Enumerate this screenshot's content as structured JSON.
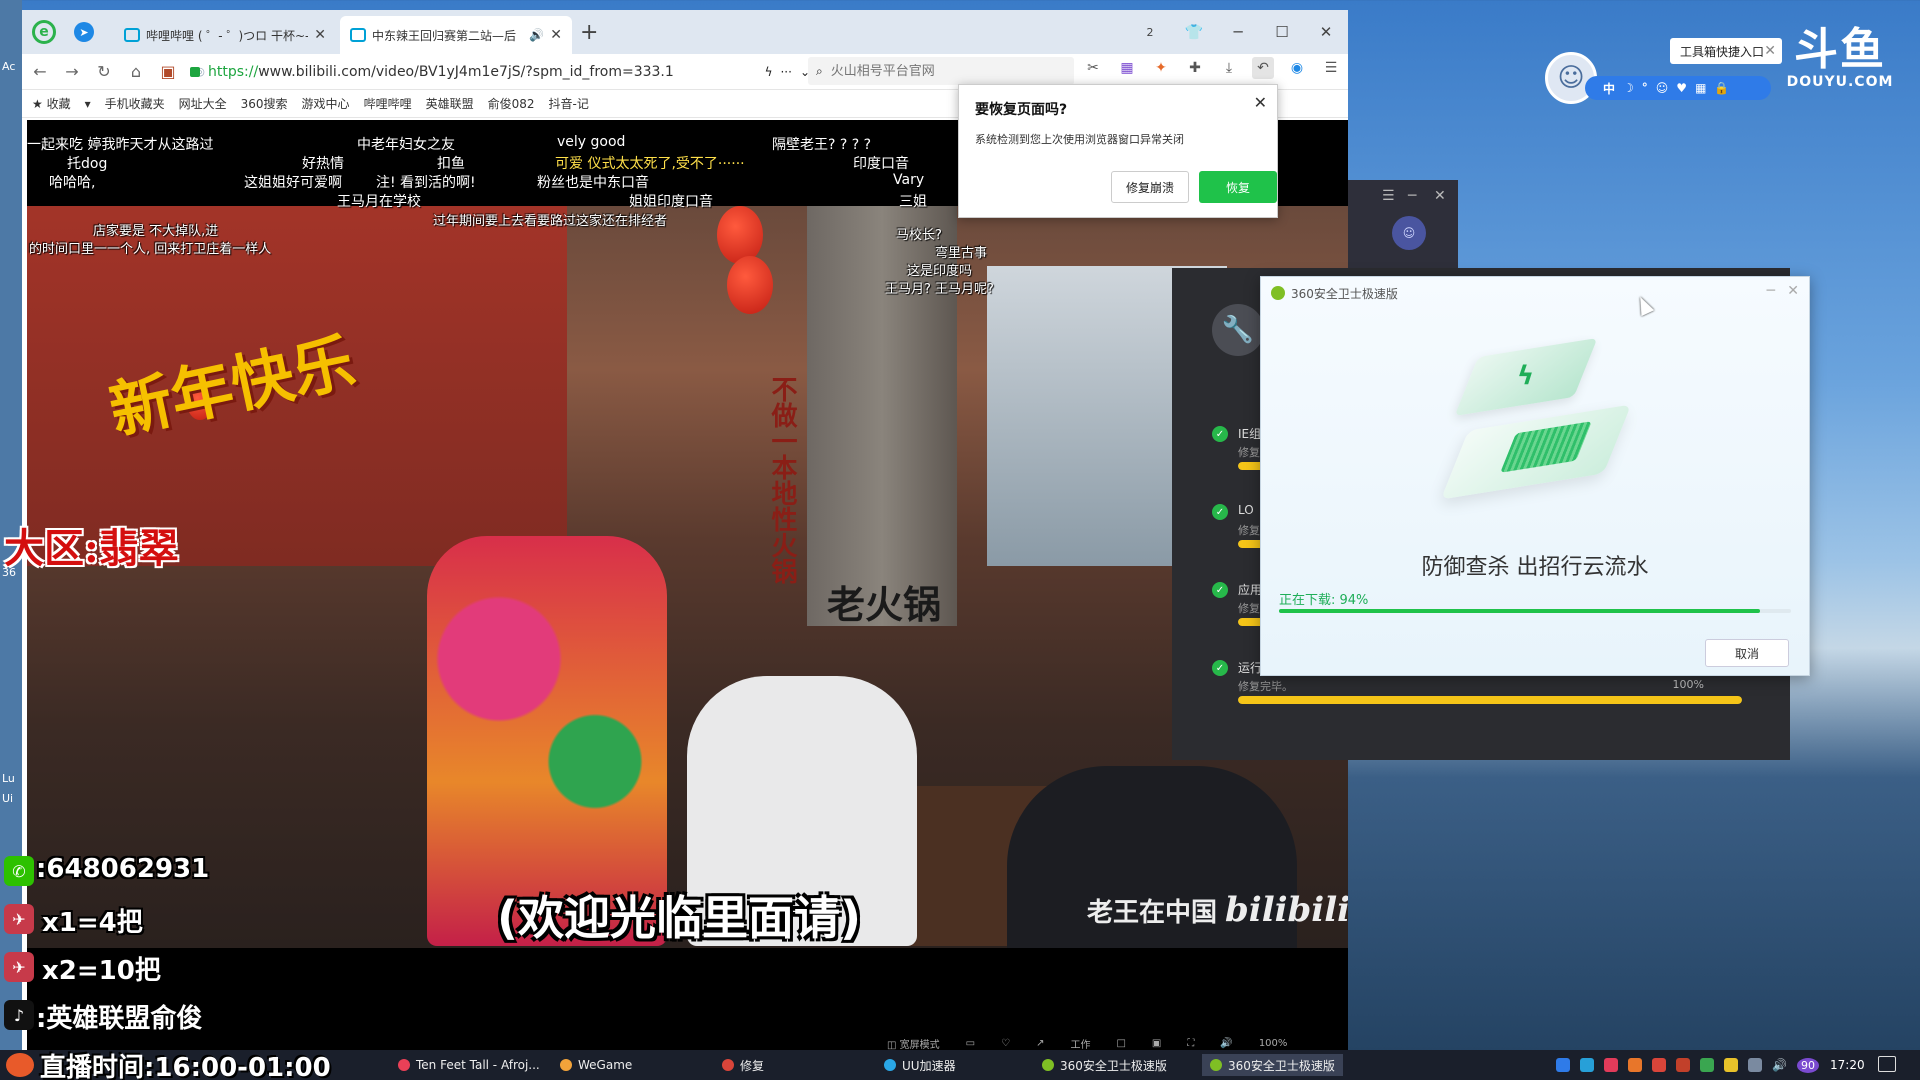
{
  "desktop": {
    "left_labels": [
      "Ac",
      "36",
      "Lu",
      "Ui"
    ],
    "douyu_logo": {
      "big": "斗鱼",
      "small": "DOUYU.COM"
    },
    "toolbox_tip": "工具箱快捷入口",
    "ime_keys": [
      "中",
      "☽",
      "°",
      "☺",
      "♥",
      "▦",
      "🔒"
    ]
  },
  "browser": {
    "tabs": [
      {
        "label": "哔哩哔哩 ( ゜- ゜)つロ 干杯~-b"
      },
      {
        "label": "中东辣王回归赛第二站—后"
      }
    ],
    "url_prefix": "https://",
    "url_rest": "www.bilibili.com/video/BV1yJ4m1e7jS/?spm_id_from=333.1",
    "search_placeholder": "火山相号平台官网",
    "window_badge": "2",
    "bookmarks": [
      "★ 收藏",
      "▾",
      "手机收藏夹",
      "网址大全",
      "360搜索",
      "游戏中心",
      "哔哩哔哩",
      "英雄联盟",
      "俞俊082",
      "抖音-记"
    ]
  },
  "restore_dialog": {
    "title": "要恢复页面吗?",
    "desc": "系统检测到您上次使用浏览器窗口异常关闭",
    "btn_fix": "修复崩溃",
    "btn_restore": "恢复"
  },
  "video": {
    "danmaku": [
      {
        "text": "一起来吃   婷我昨天才从这路过",
        "y": false
      },
      {
        "text": "中老年妇女之友",
        "y": false
      },
      {
        "text": "vely  good",
        "y": false
      },
      {
        "text": "隔壁老王? ? ? ?",
        "y": false
      },
      {
        "text": "托dog",
        "y": false
      },
      {
        "text": "好热情",
        "y": false
      },
      {
        "text": "扣鱼",
        "y": false
      },
      {
        "text": "可爱  仪式太太死了,受不了······",
        "y": true
      },
      {
        "text": "印度口音",
        "y": false
      },
      {
        "text": "哈哈哈,",
        "y": false
      },
      {
        "text": "这姐姐好可爱啊",
        "y": false
      },
      {
        "text": "注! 看到活的啊!",
        "y": false
      },
      {
        "text": "粉丝也是中东口音",
        "y": false
      },
      {
        "text": "Vary",
        "y": false
      },
      {
        "text": "王马月在学校",
        "y": false
      },
      {
        "text": "姐姐印度口音",
        "y": false
      },
      {
        "text": "三姐",
        "y": false
      },
      {
        "text": "过年期间要上去看要路过这家还在排经者",
        "y": false
      },
      {
        "text": "马校长?",
        "y": false
      },
      {
        "text": "弯里古事",
        "y": false
      },
      {
        "text": "这是印度吗",
        "y": false
      },
      {
        "text": "王马月? 王马月呢?",
        "y": false
      },
      {
        "text": "店家要是 不大掉队,进",
        "y": false
      },
      {
        "text": "的时间口里一一个人, 回来打卫庄着一样人",
        "y": false
      }
    ],
    "sign_newyear": "新年快乐",
    "sign_vertical": "不做一本地性火锅",
    "sign_laohuoguo": "老火锅",
    "subtitle": "(欢迎光临里面请)",
    "watermark_text": "老王在中国",
    "watermark_logo": "bilibili",
    "player_controls": [
      "◫ 宽屏模式",
      "▭",
      "♡",
      "↗",
      "工作",
      "□",
      "▣",
      "⛶",
      "🔊",
      "100%"
    ]
  },
  "overlay": {
    "zone": "大区:翡翠",
    "wechat": ":648062931",
    "x1": "x1=4把",
    "x2": "x2=10把",
    "douyin": ":英雄联盟俞俊",
    "live_time": "直播时间:16:00-01:00"
  },
  "repair_window": {
    "items": [
      {
        "name": "IE组件",
        "sub": "修复",
        "progress": 100,
        "pct": ""
      },
      {
        "name": "LO",
        "sub": "修复",
        "progress": 100,
        "pct": ""
      },
      {
        "name": "应用",
        "sub": "修复",
        "progress": 100,
        "pct": ""
      },
      {
        "name": "运行",
        "sub": "修复完毕。",
        "progress": 100,
        "pct": "100%"
      }
    ]
  },
  "safe_window": {
    "title": "360安全卫士极速版",
    "slogan": "防御查杀  出招行云流水",
    "download_label": "正在下载: 94%",
    "download_progress": 94,
    "cancel": "取消"
  },
  "taskbar": {
    "items": [
      {
        "label": "Ten Feet Tall - Afroj...",
        "color": "#e94057"
      },
      {
        "label": "WeGame",
        "color": "#f2a33a"
      },
      {
        "label": "修复",
        "color": "#d9453a"
      },
      {
        "label": "UU加速器",
        "color": "#2aa7e6"
      },
      {
        "label": "360安全卫士极速版",
        "color": "#7fbf24"
      },
      {
        "label": "360安全卫士极速版",
        "color": "#7fbf24"
      }
    ],
    "tray_badge": "90",
    "clock": "17:20"
  }
}
